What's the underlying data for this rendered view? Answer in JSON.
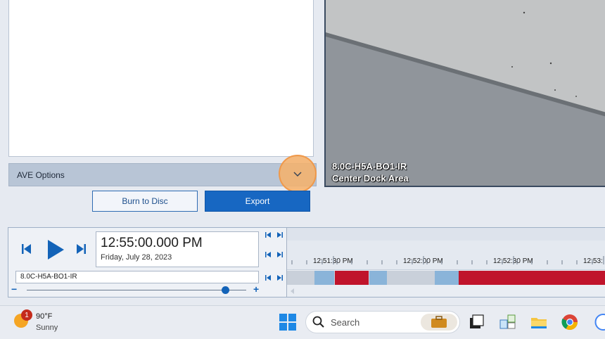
{
  "panel": {
    "ave_options_label": "AVE Options",
    "burn_label": "Burn to Disc",
    "export_label": "Export"
  },
  "video": {
    "camera_line1": "8.0C-H5A-BO1-IR",
    "camera_line2": "Center Dock Area"
  },
  "playback": {
    "time": "12:55:00.000 PM",
    "date": "Friday, July 28, 2023",
    "camera_field": "8.0C-H5A-BO1-IR",
    "zoom_minus": "−",
    "zoom_plus": "+",
    "zoom_level": 0.9
  },
  "timeline": {
    "ticks": [
      "12:51:30 PM",
      "12:52:00 PM",
      "12:52:30 PM",
      "12:53:"
    ]
  },
  "taskbar": {
    "weather_badge": "1",
    "temperature": "90°F",
    "condition": "Sunny",
    "search_placeholder": "Search"
  },
  "colors": {
    "accent": "#1767c2",
    "recording_motion": "#c0142b",
    "recording_normal": "#8ab4d9",
    "ave_highlight": "#f6b068"
  }
}
